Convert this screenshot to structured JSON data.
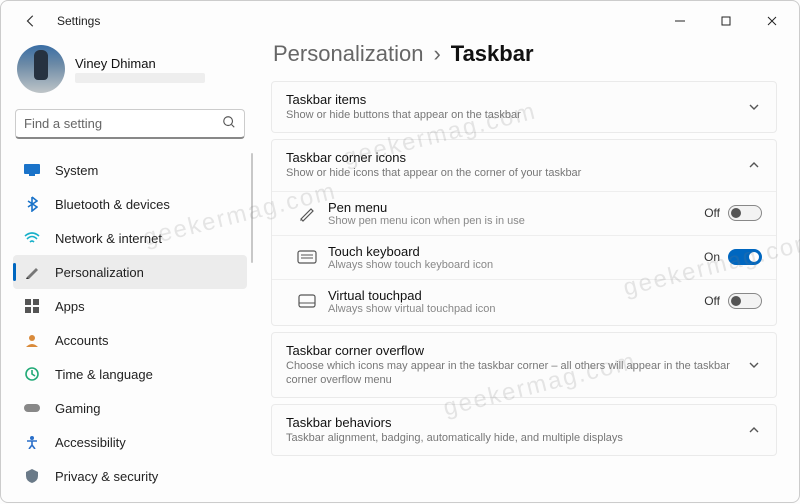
{
  "window": {
    "title": "Settings"
  },
  "user": {
    "name": "Viney Dhiman"
  },
  "search": {
    "placeholder": "Find a setting"
  },
  "sidebar": {
    "items": [
      {
        "label": "System",
        "icon": "system"
      },
      {
        "label": "Bluetooth & devices",
        "icon": "bluetooth"
      },
      {
        "label": "Network & internet",
        "icon": "network"
      },
      {
        "label": "Personalization",
        "icon": "personalization",
        "selected": true
      },
      {
        "label": "Apps",
        "icon": "apps"
      },
      {
        "label": "Accounts",
        "icon": "accounts"
      },
      {
        "label": "Time & language",
        "icon": "time"
      },
      {
        "label": "Gaming",
        "icon": "gaming"
      },
      {
        "label": "Accessibility",
        "icon": "accessibility"
      },
      {
        "label": "Privacy & security",
        "icon": "privacy"
      }
    ]
  },
  "breadcrumb": {
    "parent": "Personalization",
    "current": "Taskbar"
  },
  "sections": {
    "taskbar_items": {
      "title": "Taskbar items",
      "desc": "Show or hide buttons that appear on the taskbar",
      "expanded": false
    },
    "corner_icons": {
      "title": "Taskbar corner icons",
      "desc": "Show or hide icons that appear on the corner of your taskbar",
      "expanded": true,
      "rows": [
        {
          "title": "Pen menu",
          "desc": "Show pen menu icon when pen is in use",
          "state_label": "Off",
          "on": false
        },
        {
          "title": "Touch keyboard",
          "desc": "Always show touch keyboard icon",
          "state_label": "On",
          "on": true
        },
        {
          "title": "Virtual touchpad",
          "desc": "Always show virtual touchpad icon",
          "state_label": "Off",
          "on": false
        }
      ]
    },
    "corner_overflow": {
      "title": "Taskbar corner overflow",
      "desc": "Choose which icons may appear in the taskbar corner – all others will appear in the taskbar corner overflow menu",
      "expanded": false
    },
    "behaviors": {
      "title": "Taskbar behaviors",
      "desc": "Taskbar alignment, badging, automatically hide, and multiple displays",
      "expanded": true
    }
  },
  "watermark": "geekermag.com",
  "colors": {
    "accent": "#0067c0"
  }
}
